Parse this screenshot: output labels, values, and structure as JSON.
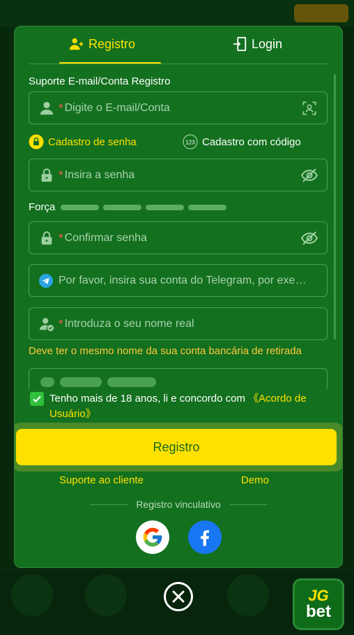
{
  "tabs": {
    "register_label": "Registro",
    "login_label": "Login"
  },
  "form": {
    "section_label": "Suporte E-mail/Conta Registro",
    "email_placeholder": "Digite o E-mail/Conta",
    "required_mark": "*",
    "mode_password_label": "Cadastro de senha",
    "mode_code_label": "Cadastro com código",
    "password_placeholder": "Insira a senha",
    "strength_label": "Força",
    "confirm_placeholder": "Confirmar senha",
    "telegram_placeholder": "Por favor, insira sua conta do Telegram, por exe…",
    "realname_placeholder": "Introduza o seu nome real",
    "realname_hint": "Deve ter o mesmo nome da sua conta bancária de retirada",
    "agree_checked": true,
    "agree_text": "Tenho mais de 18 anos, li e concordo com ",
    "agree_link": "《Acordo de Usuário》"
  },
  "actions": {
    "register_button": "Registro",
    "support_link": "Suporte ao cliente",
    "demo_link": "Demo"
  },
  "social": {
    "divider_label": "Registro vinculativo",
    "providers": [
      "google-icon",
      "facebook-icon"
    ]
  },
  "logo": {
    "line1": "JG",
    "line2": "bet"
  },
  "colors": {
    "accent": "#ffe100",
    "panel": "#13701f",
    "warning": "#ffc93a",
    "required": "#ff5a4a"
  }
}
